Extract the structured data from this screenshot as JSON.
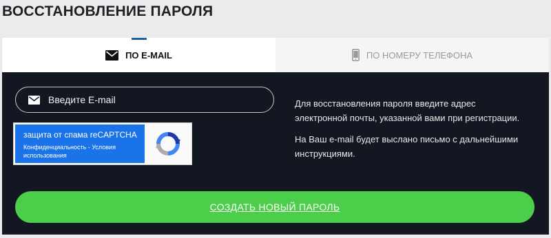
{
  "page": {
    "title": "ВОССТАНОВЛЕНИЕ ПАРОЛЯ"
  },
  "tabs": [
    {
      "label": "ПО E-MAIL",
      "icon": "envelope-icon",
      "active": true
    },
    {
      "label": "ПО НОМЕРУ ТЕЛЕФОНА",
      "icon": "phone-icon",
      "active": false
    }
  ],
  "form": {
    "email_placeholder": "Введите E-mail",
    "submit_label": "СОЗДАТЬ НОВЫЙ ПАРОЛЬ"
  },
  "recaptcha": {
    "title": "защита от спама reCAPTCHA",
    "links": "Конфиденциальность - Условия использования"
  },
  "info": {
    "paragraph1": "Для восстановления пароля введите адрес электронной почты, указанной вами при регистрации.",
    "paragraph2": "На Ваш e-mail будет выслано письмо с дальнейшими инструкциями."
  },
  "colors": {
    "panel_bg": "#131721",
    "accent_green": "#4cce4a",
    "recaptcha_blue": "#1a73e8",
    "active_tab_marker": "#1e5fa8"
  }
}
